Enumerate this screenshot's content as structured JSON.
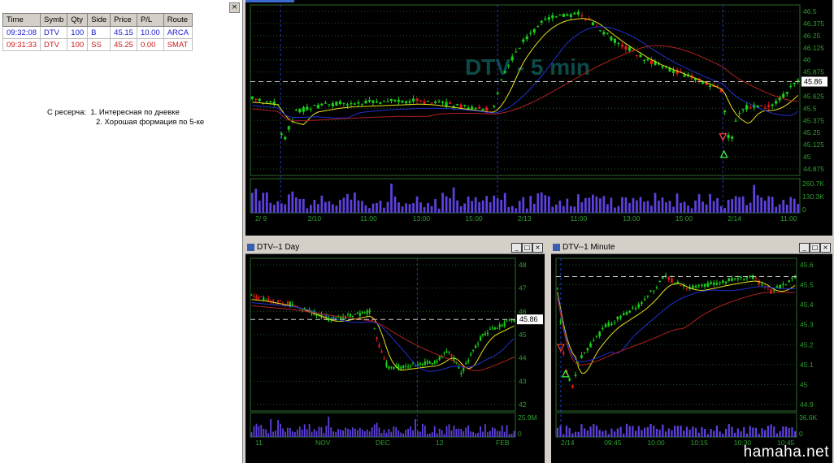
{
  "trades": {
    "columns": [
      "Time",
      "Symb",
      "Qty",
      "Side",
      "Price",
      "P/L",
      "Route"
    ],
    "rows": [
      {
        "cells": [
          "09:32:08",
          "DTV",
          "100",
          "B",
          "45.15",
          "10.00",
          "ARCA"
        ],
        "kind": "buy"
      },
      {
        "cells": [
          "09:31:33",
          "DTV",
          "100",
          "SS",
          "45.25",
          "0.00",
          "SMAT"
        ],
        "kind": "sell"
      }
    ],
    "close_glyph": "×",
    "note_label": "С ресерча:",
    "note_lines": [
      "1. Интересная по дневке",
      "2. Хорошая формация по 5-ке"
    ]
  },
  "charts": {
    "five_min": {
      "watermark": "DTV - 5 min",
      "last_price": "45.86",
      "price_ticks": [
        "46.5",
        "46.375",
        "46.25",
        "46.125",
        "46",
        "45.875",
        "45.75",
        "45.625",
        "45.5",
        "45.375",
        "45.25",
        "45.125",
        "45",
        "44.875"
      ],
      "volume_ticks": [
        "260.7K",
        "130.3K",
        "0"
      ],
      "time_labels": [
        "2/ 9",
        "2/10",
        "11:00",
        "13:00",
        "15:00",
        "2/13",
        "11:00",
        "13:00",
        "15:00",
        "2/14",
        "11:00"
      ]
    },
    "day": {
      "title": "DTV--1 Day",
      "last_price": "45.86",
      "price_ticks": [
        "48",
        "47",
        "46",
        "45",
        "44",
        "43",
        "42"
      ],
      "volume_ticks": [
        "25.9M",
        "0"
      ],
      "time_labels": [
        "11",
        "NOV",
        "DEC",
        "12",
        "FEB"
      ]
    },
    "minute": {
      "title": "DTV--1 Minute",
      "price_ticks": [
        "45.6",
        "45.5",
        "45.4",
        "45.3",
        "45.2",
        "45.1",
        "45",
        "44.9"
      ],
      "volume_ticks": [
        "36.6K",
        "0"
      ],
      "time_labels": [
        "2/14",
        "09:45",
        "10:00",
        "10:15",
        "10:30",
        "10:45"
      ]
    }
  },
  "colors": {
    "up": "#18d018",
    "down": "#e01818",
    "sma_fast": "#e8e020",
    "sma_mid": "#2030d0",
    "sma_slow": "#b02020",
    "volume": "#6040e0",
    "grid": "#1e5a1e"
  },
  "window_buttons": {
    "min": "_",
    "max": "□",
    "close": "×"
  },
  "watermark_site": "hamaha.net"
}
